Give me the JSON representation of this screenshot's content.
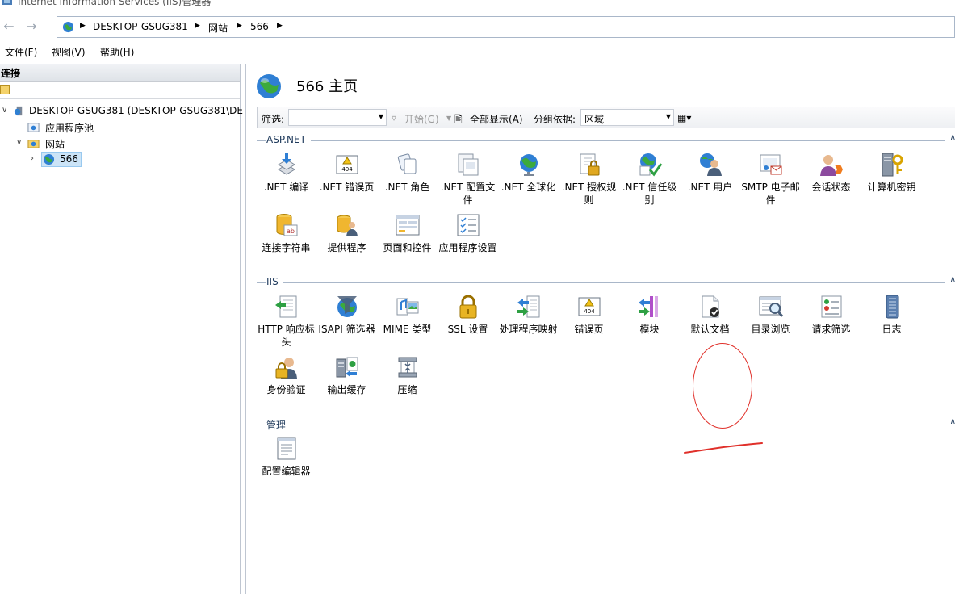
{
  "window": {
    "title": "Internet Information Services (IIS)管理器"
  },
  "address": {
    "crumbs": [
      "DESKTOP-GSUG381",
      "网站",
      "566"
    ]
  },
  "menu": {
    "items": [
      "文件(F)",
      "视图(V)",
      "帮助(H)"
    ]
  },
  "connections": {
    "header": "连接",
    "tree": {
      "server": "DESKTOP-GSUG381 (DESKTOP-GSUG381\\DE",
      "app_pools": "应用程序池",
      "sites": "网站",
      "site": "566"
    }
  },
  "home": {
    "title": "566 主页"
  },
  "filter": {
    "label": "筛选:",
    "go": "开始(G)",
    "show_all": "全部显示(A)",
    "group_by": "分组依据:",
    "group_value": "区域"
  },
  "groups": {
    "aspnet": {
      "label": "ASP.NET",
      "items": [
        ".NET 编译",
        ".NET 错误页",
        ".NET 角色",
        ".NET 配置文件",
        ".NET 全球化",
        ".NET 授权规则",
        ".NET 信任级别",
        ".NET 用户",
        "SMTP 电子邮件",
        "会话状态",
        "计算机密钥",
        "连接字符串",
        "提供程序",
        "页面和控件",
        "应用程序设置"
      ]
    },
    "iis": {
      "label": "IIS",
      "items": [
        "HTTP 响应标头",
        "ISAPI 筛选器",
        "MIME 类型",
        "SSL 设置",
        "处理程序映射",
        "错误页",
        "模块",
        "默认文档",
        "目录浏览",
        "请求筛选",
        "日志",
        "身份验证",
        "输出缓存",
        "压缩"
      ]
    },
    "manage": {
      "label": "管理",
      "items": [
        "配置编辑器"
      ]
    }
  },
  "colors": {
    "accent": "#1e395b",
    "annotation": "#e0302a",
    "selection": "#cce4f7"
  }
}
